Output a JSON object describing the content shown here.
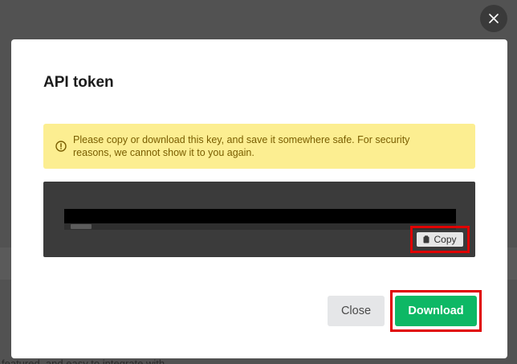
{
  "modal": {
    "title": "API token",
    "alert_message": "Please copy or download this key, and save it somewhere safe. For security reasons, we cannot show it to you again.",
    "copy_label": "Copy",
    "close_label": "Close",
    "download_label": "Download"
  },
  "background": {
    "partial_text": "featured, and easy to integrate with"
  },
  "icons": {
    "overlay_close": "close-icon",
    "alert": "warning-circle-icon",
    "copy": "clipboard-icon"
  },
  "colors": {
    "alert_bg": "#fcee91",
    "alert_text": "#7a5e00",
    "download_green": "#0db865",
    "highlight_red": "#e00000"
  }
}
